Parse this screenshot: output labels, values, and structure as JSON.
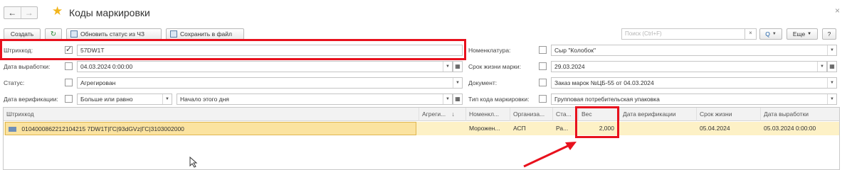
{
  "window": {
    "title": "Коды маркировки",
    "back_icon": "arrow-left-icon",
    "forward_icon": "arrow-right-icon",
    "close_glyph": "×"
  },
  "toolbar": {
    "create_label": "Создать",
    "update_status_label": "Обновить статус из ЧЗ",
    "save_file_label": "Сохранить в файл",
    "search_placeholder": "Поиск (Ctrl+F)",
    "search_clear": "×",
    "search_button": "Q",
    "more_label": "Еще",
    "help_label": "?"
  },
  "filters": {
    "barcode": {
      "label": "Штрихкод:",
      "checked": true,
      "value": "57DW1T"
    },
    "prod_date": {
      "label": "Дата выработки:",
      "checked": false,
      "value": "04.03.2024  0:00:00"
    },
    "status": {
      "label": "Статус:",
      "checked": false,
      "value": "Агрегирован"
    },
    "verify_date": {
      "label": "Дата верификации:",
      "checked": false,
      "condition": "Больше или равно",
      "value": "Начало этого дня"
    },
    "nomenclature": {
      "label": "Номенклатура:",
      "checked": false,
      "value": "Сыр \"Колобок\""
    },
    "shelf_life": {
      "label": "Срок жизни марки:",
      "checked": false,
      "value": "29.03.2024"
    },
    "document": {
      "label": "Документ:",
      "checked": false,
      "value": "Заказ марок №ЦБ-55 от 04.03.2024"
    },
    "code_type": {
      "label": "Тип кода маркировки:",
      "checked": false,
      "value": "Групповая потребительская упаковка"
    }
  },
  "grid": {
    "columns": [
      "Штрихкод",
      "Агреги...",
      "Номенкл...",
      "Организа...",
      "Ста...",
      "Вес",
      "Дата верификации",
      "Срок жизни",
      "Дата выработки"
    ],
    "sort_indicator": "↓",
    "rows": [
      {
        "barcode": "0104000862212104215 7DW1T|ГС|93dGVz|ГС|3103002000",
        "aggregate": "",
        "nomenclature": "Морожен...",
        "organization": "АСП",
        "status": "Ра...",
        "weight": "2,000",
        "verify_date": "",
        "shelf_life": "05.04.2024",
        "prod_date": "05.03.2024 0:00:00"
      }
    ]
  },
  "colors": {
    "highlight_red": "#e8111d",
    "row_selected": "#fdf1c6",
    "star": "#f2b51d"
  }
}
